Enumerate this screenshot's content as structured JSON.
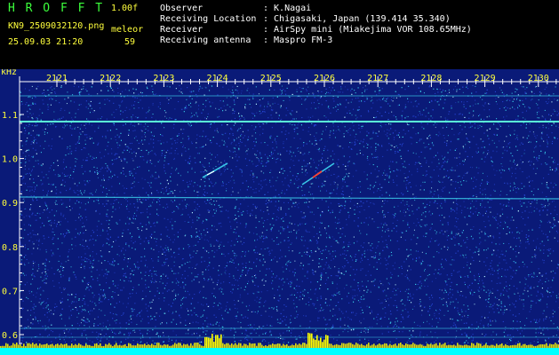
{
  "header": {
    "logo": "H R O F F T",
    "version": "1.00f",
    "filename": "KN9_2509032120.png",
    "datetime": "25.09.03 21:20",
    "mode_label": "meleor",
    "count": "59",
    "info": [
      {
        "label": "Observer",
        "value": ": K.Nagai"
      },
      {
        "label": "Receiving Location",
        "value": ": Chigasaki, Japan (139.414 35.340)"
      },
      {
        "label": "Receiver",
        "value": ": AirSpy mini (Miakejima VOR 108.65MHz)"
      },
      {
        "label": "Receiving antenna",
        "value": ": Maspro FM-3"
      }
    ]
  },
  "spectrogram": {
    "y_unit": "kHz",
    "y_ticks": [
      "1.1",
      "1.0",
      "0.9",
      "0.8",
      "0.7",
      "0.6"
    ],
    "x_ticks": [
      "2121",
      "2122",
      "2123",
      "2124",
      "2125",
      "2126",
      "2127",
      "2128",
      "2129",
      "2130"
    ]
  },
  "colors": {
    "background": "#000000",
    "plot_bg": "#0a1a78",
    "noise_cyan": "#39c6e6",
    "noise_blue": "#2848d8",
    "carrier": "#5affd8",
    "meteor_red": "#ff4030",
    "baseline": "#00ffff",
    "peak_yellow": "#ffff00",
    "label_green": "#3cff3c",
    "label_yellow": "#ffff3c"
  }
}
